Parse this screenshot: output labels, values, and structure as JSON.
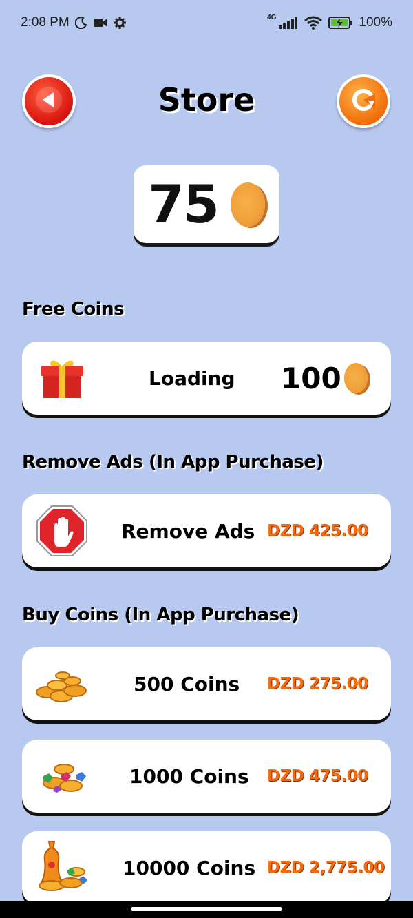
{
  "status_bar": {
    "time": "2:08 PM",
    "network": "4G",
    "battery": "100%"
  },
  "header": {
    "title": "Store",
    "back_icon": "back-arrow-icon",
    "refresh_icon": "refresh-icon"
  },
  "balance": {
    "value": "75",
    "icon": "coin-icon"
  },
  "free_coins": {
    "heading": "Free Coins",
    "card": {
      "label": "Loading",
      "reward": "100",
      "icon": "gift-icon"
    }
  },
  "remove_ads": {
    "heading": "Remove Ads (In App Purchase)",
    "card": {
      "label": "Remove Ads",
      "price": "DZD 425.00",
      "icon": "stop-hand-icon"
    }
  },
  "buy_coins": {
    "heading": "Buy Coins (In App Purchase)",
    "items": [
      {
        "label": "500 Coins",
        "price": "DZD 275.00",
        "icon": "coin-pile-icon"
      },
      {
        "label": "1000 Coins",
        "price": "DZD 475.00",
        "icon": "coins-gems-icon"
      },
      {
        "label": "10000 Coins",
        "price": "DZD 2,775.00",
        "icon": "treasure-icon"
      }
    ]
  },
  "colors": {
    "background": "#b8c9ef",
    "price": "#f36b10",
    "back_button": "#d8140f",
    "refresh_button": "#f06d0a",
    "coin": "#f0a03a"
  }
}
